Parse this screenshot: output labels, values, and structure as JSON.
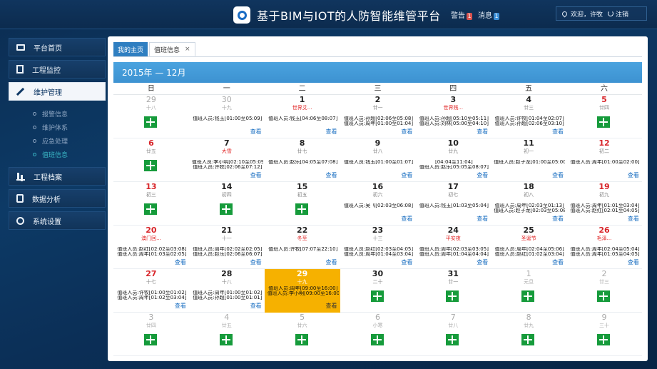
{
  "header": {
    "title": "基于BIM与IOT的人防智能维管平台",
    "alert_label": "警告",
    "alert_count": "1",
    "message_label": "消息",
    "message_count": "1",
    "welcome": "欢迎，许牧",
    "logout": "注销"
  },
  "sidebar": {
    "items": [
      {
        "label": "平台首页",
        "icon": "truck-icon",
        "active": false
      },
      {
        "label": "工程监控",
        "icon": "document-icon",
        "active": false
      },
      {
        "label": "维护管理",
        "icon": "tools-icon",
        "active": true,
        "children": [
          {
            "label": "报警信息",
            "active": false
          },
          {
            "label": "维护体系",
            "active": false
          },
          {
            "label": "应急处理",
            "active": false
          },
          {
            "label": "值班信息",
            "active": true
          }
        ]
      },
      {
        "label": "工程档案",
        "icon": "bar-chart-icon",
        "active": false
      },
      {
        "label": "数据分析",
        "icon": "clipboard-icon",
        "active": false
      },
      {
        "label": "系统设置",
        "icon": "wrench-icon",
        "active": false
      }
    ]
  },
  "tabs": {
    "home": "我的主页",
    "current": "值班信息",
    "close": "×"
  },
  "calendar": {
    "title": "2015年 — 12月",
    "weekdays": [
      "日",
      "一",
      "二",
      "三",
      "四",
      "五",
      "六"
    ],
    "view_label": "查看",
    "weeks": [
      [
        {
          "day": "29",
          "lunar": "十八",
          "other": true,
          "add": true
        },
        {
          "day": "30",
          "lunar": "十九",
          "other": true,
          "duties": [
            "值班人员:钱玉[01:00至05:09]"
          ]
        },
        {
          "day": "1",
          "lunar": "世界艾...",
          "hol": true,
          "duties": [
            "值班人员:钱玉[04:06至08:07]"
          ]
        },
        {
          "day": "2",
          "lunar": "廿一",
          "duties": [
            "值班人员:孙超[02:06至05:08]",
            "值班人员:周年[01:00至01:04]"
          ]
        },
        {
          "day": "3",
          "lunar": "世界残...",
          "hol": true,
          "duties": [
            "值班人员:孙超[05:10至05:11]",
            "值班人员:刘林[05:00至04:10]"
          ]
        },
        {
          "day": "4",
          "lunar": "廿三",
          "duties": [
            "值班人员:许牧[01:04至02:07]",
            "值班人员:孙超[02:06至03:10]"
          ]
        },
        {
          "day": "5",
          "lunar": "廿四",
          "wkend": true,
          "add": true
        }
      ],
      [
        {
          "day": "6",
          "lunar": "廿五",
          "wkend": true,
          "add": true
        },
        {
          "day": "7",
          "lunar": "大雪",
          "hol": true,
          "duties": [
            "值班人员:李小明[02:10至05:09]",
            "值班人员:许牧[02:06至07:12]"
          ]
        },
        {
          "day": "8",
          "lunar": "廿七",
          "duties": [
            "值班人员:赵乐[04:05至07:08]"
          ]
        },
        {
          "day": "9",
          "lunar": "廿八",
          "duties": [
            "值班人员:钱玉[01:00至01:07]"
          ]
        },
        {
          "day": "10",
          "lunar": "廿九",
          "duties": [
            "[04:04至11:04]",
            "值班人员:赵乐[05:05至08:07]"
          ]
        },
        {
          "day": "11",
          "lunar": "初一",
          "duties": [
            "值班人员:赵子龙[01:00至05:00]"
          ]
        },
        {
          "day": "12",
          "lunar": "初二",
          "wkend": true,
          "duties": [
            "值班人员:周年[01:00至02:00]"
          ]
        }
      ],
      [
        {
          "day": "13",
          "lunar": "初三",
          "wkend": true,
          "add": true
        },
        {
          "day": "14",
          "lunar": "初四",
          "add": true
        },
        {
          "day": "15",
          "lunar": "初五",
          "add": true
        },
        {
          "day": "16",
          "lunar": "初六",
          "duties": [
            "值班人员:吴飞[02:03至06:08]"
          ]
        },
        {
          "day": "17",
          "lunar": "初七",
          "duties": [
            "值班人员:钱玉[01:03至05:04]"
          ]
        },
        {
          "day": "18",
          "lunar": "初八",
          "duties": [
            "值班人员:周年[02:03至01:13]",
            "值班人员:赵子龙[02:03至05:08]"
          ]
        },
        {
          "day": "19",
          "lunar": "初九",
          "wkend": true,
          "duties": [
            "值班人员:周年[01:01至03:04]",
            "值班人员:赵红[02:01至04:05]"
          ]
        }
      ],
      [
        {
          "day": "20",
          "lunar": "澳门回...",
          "wkend": true,
          "hol": true,
          "duties": [
            "值班人员:赵红[02:02至03:08]",
            "值班人员:周年[01:03至02:05]"
          ]
        },
        {
          "day": "21",
          "lunar": "十一",
          "duties": [
            "值班人员:周年[02:02至02:05]",
            "值班人员:赵乐[02:06至06:07]"
          ]
        },
        {
          "day": "22",
          "lunar": "冬至",
          "hol": true,
          "duties": [
            "值班人员:许牧[07:07至22:10]"
          ]
        },
        {
          "day": "23",
          "lunar": "十三",
          "duties": [
            "值班人员:赵红[02:03至04:05]",
            "值班人员:周年[01:04至03:04]"
          ]
        },
        {
          "day": "24",
          "lunar": "平安夜",
          "hol": true,
          "duties": [
            "值班人员:周年[02:03至03:05]",
            "值班人员:周年[01:04至04:04]"
          ]
        },
        {
          "day": "25",
          "lunar": "圣诞节",
          "hol": true,
          "duties": [
            "值班人员:周年[02:04至05:06]",
            "值班人员:赵红[01:02至03:04]"
          ]
        },
        {
          "day": "26",
          "lunar": "毛泽...",
          "wkend": true,
          "hol": true,
          "duties": [
            "值班人员:周年[02:04至05:04]",
            "值班人员:周年[01:05至04:05]"
          ]
        }
      ],
      [
        {
          "day": "27",
          "lunar": "十七",
          "wkend": true,
          "duties": [
            "值班人员:许牧[01:00至01:02]",
            "值班人员:周年[01:02至03:04]"
          ]
        },
        {
          "day": "28",
          "lunar": "十八",
          "duties": [
            "值班人员:周年[01:00至01:02]",
            "值班人员:孙超[01:00至01:01]"
          ]
        },
        {
          "day": "29",
          "lunar": "十九",
          "today": true,
          "duties": [
            "值班人员:周年[09:00至16:00]",
            "值班人员:李小明[09:00至16:00]"
          ]
        },
        {
          "day": "30",
          "lunar": "二十",
          "add": true
        },
        {
          "day": "31",
          "lunar": "廿一",
          "add": true
        },
        {
          "day": "1",
          "lunar": "元旦",
          "other": true,
          "add": true
        },
        {
          "day": "2",
          "lunar": "廿三",
          "other": true,
          "add": true
        }
      ],
      [
        {
          "day": "3",
          "lunar": "廿四",
          "other": true,
          "add": true
        },
        {
          "day": "4",
          "lunar": "廿五",
          "other": true,
          "add": true
        },
        {
          "day": "5",
          "lunar": "廿六",
          "other": true,
          "add": true
        },
        {
          "day": "6",
          "lunar": "小寒",
          "other": true,
          "add": true
        },
        {
          "day": "7",
          "lunar": "廿八",
          "other": true,
          "add": true
        },
        {
          "day": "8",
          "lunar": "廿九",
          "other": true,
          "add": true
        },
        {
          "day": "9",
          "lunar": "三十",
          "other": true,
          "add": true
        }
      ]
    ]
  }
}
